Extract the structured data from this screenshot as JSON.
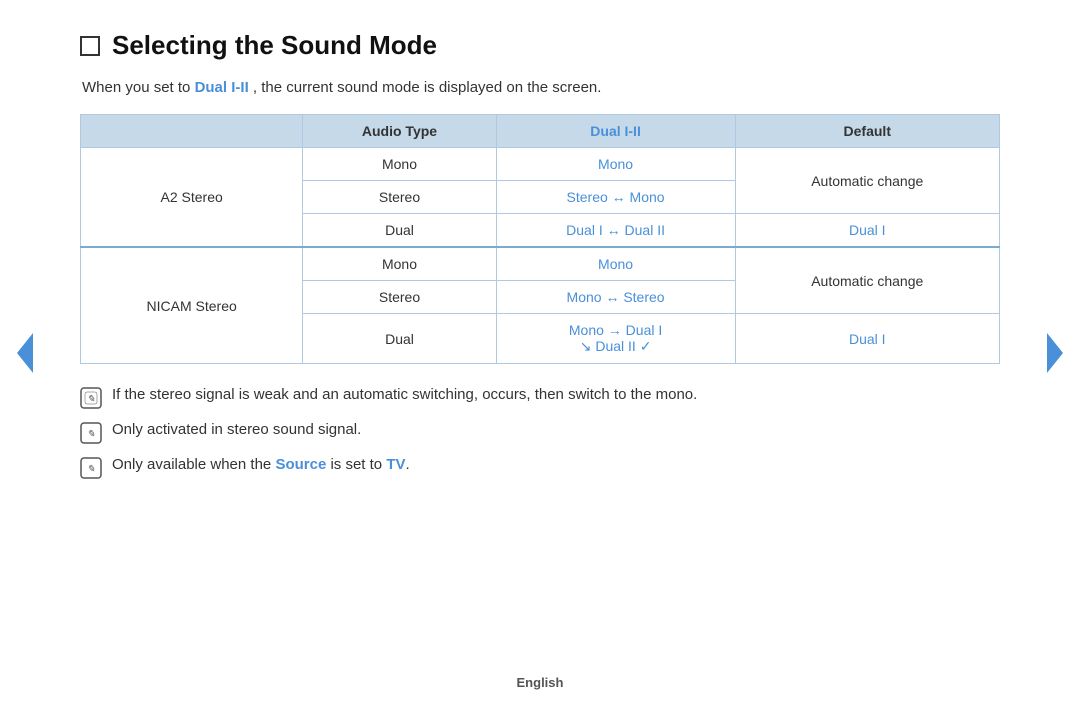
{
  "page": {
    "title": "Selecting the Sound Mode",
    "intro": {
      "before": "When you set to ",
      "highlight": "Dual I-II",
      "after": ", the current sound mode is displayed on the screen."
    },
    "table": {
      "headers": [
        "",
        "Audio Type",
        "Dual I-II",
        "Default"
      ],
      "groups": [
        {
          "group_label": "A2 Stereo",
          "rows": [
            {
              "audio_type": "Mono",
              "dual": "Mono",
              "dual_color": true,
              "default": "Automatic change",
              "default_color": false,
              "default_rowspan": 2
            },
            {
              "audio_type": "Stereo",
              "dual": "Stereo ↔ Mono",
              "dual_color": true,
              "default": null
            },
            {
              "audio_type": "Dual",
              "dual": "Dual I ↔ Dual II",
              "dual_color": true,
              "default": "Dual I",
              "default_color": true,
              "default_rowspan": 1
            }
          ]
        },
        {
          "group_label": "NICAM Stereo",
          "rows": [
            {
              "audio_type": "Mono",
              "dual": "Mono",
              "dual_color": true,
              "default": "Automatic change",
              "default_color": false,
              "default_rowspan": 2
            },
            {
              "audio_type": "Stereo",
              "dual": "Mono ↔ Stereo",
              "dual_color": true,
              "default": null
            },
            {
              "audio_type": "Dual",
              "dual_line1": "Mono → Dual I",
              "dual_line2": "↘ Dual II ✓",
              "dual_color": true,
              "default": "Dual I",
              "default_color": true,
              "default_rowspan": 1
            }
          ]
        }
      ]
    },
    "notes": [
      {
        "id": "note1",
        "text": "If the stereo signal is weak and an automatic switching, occurs, then switch to the mono."
      },
      {
        "id": "note2",
        "text": "Only activated in stereo sound signal."
      },
      {
        "id": "note3",
        "before": "Only available when the ",
        "highlight1": "Source",
        "middle": " is set to ",
        "highlight2": "TV",
        "after": "."
      }
    ],
    "footer": "English",
    "nav": {
      "left_label": "previous",
      "right_label": "next"
    }
  }
}
